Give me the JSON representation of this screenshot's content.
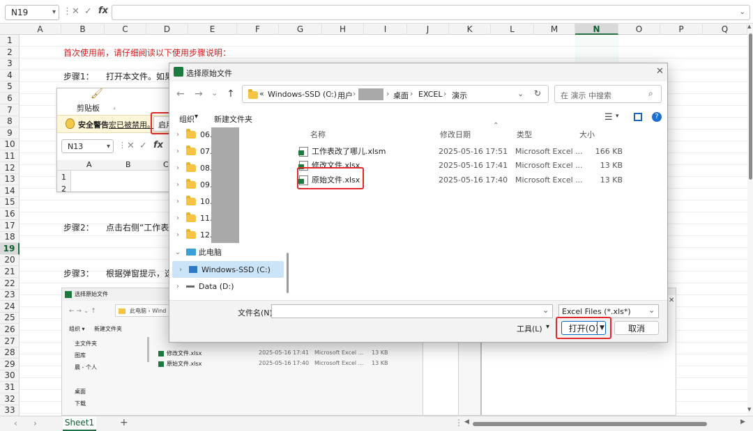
{
  "formula_bar": {
    "name_box": "N19",
    "fx": "fx"
  },
  "columns": [
    "A",
    "B",
    "C",
    "D",
    "E",
    "F",
    "G",
    "H",
    "I",
    "J",
    "K",
    "L",
    "M",
    "N",
    "O",
    "P",
    "Q"
  ],
  "selected_column": "N",
  "rows": [
    "1",
    "2",
    "3",
    "4",
    "5",
    "6",
    "7",
    "8",
    "9",
    "10",
    "11",
    "12",
    "13",
    "14",
    "15",
    "16",
    "17",
    "18",
    "19",
    "20",
    "21",
    "22",
    "23",
    "24",
    "25",
    "26",
    "27",
    "28",
    "29",
    "30",
    "31",
    "32",
    "33"
  ],
  "selected_row": "19",
  "sheet": {
    "intro": "首次使用前，请仔细阅读以下使用步骤说明：",
    "step1_label": "步骤1：",
    "step1_text": "打开本文件。如果",
    "step2_label": "步骤2：",
    "step2_text": "点击右侧“工作表",
    "step3_label": "步骤3：",
    "step3_text": "根据弹窗提示，选"
  },
  "shot1": {
    "clipboard": "剪贴板",
    "warning_label": "安全警告",
    "warning_link": "宏已被禁用。",
    "enable_btn": "启用",
    "name_box": "N13",
    "fx": "fx",
    "cols": [
      "A",
      "B",
      "C"
    ],
    "rows": [
      "1",
      "2"
    ]
  },
  "shot2": {
    "title": "选择原始文件",
    "breadcrumb": "此电脑 › Wind",
    "organize": "组织 ▾",
    "new_folder": "新建文件夹",
    "nav": [
      "主文件夹",
      "图库",
      "晨 - 个人",
      "桌面",
      "下载"
    ],
    "files": [
      {
        "name": "修改文件.xlsx",
        "date": "2025-05-16 17:41",
        "type": "Microsoft Excel ...",
        "size": "13 KB"
      },
      {
        "name": "原始文件.xlsx",
        "date": "2025-05-16 17:40",
        "type": "Microsoft Excel ...",
        "size": "13 KB"
      }
    ]
  },
  "dialog": {
    "title": "选择原始文件",
    "breadcrumb": {
      "prefix": "«",
      "drive": "Windows-SSD (C:)",
      "sep": "›",
      "users": "用户",
      "desktop": "桌面",
      "excel": "EXCEL",
      "demo": "演示"
    },
    "search_placeholder": "在 演示 中搜索",
    "organize": "组织",
    "new_folder": "新建文件夹",
    "nav_folders": [
      "06.",
      "07.",
      "08.",
      "09.",
      "10.",
      "11.",
      "12."
    ],
    "this_pc": "此电脑",
    "drive_c": "Windows-SSD (C:)",
    "drive_d": "Data (D:)",
    "headers": {
      "name": "名称",
      "date": "修改日期",
      "type": "类型",
      "size": "大小"
    },
    "files": [
      {
        "name": "工作表改了哪儿.xlsm",
        "date": "2025-05-16 17:51",
        "type": "Microsoft Excel ...",
        "size": "166 KB"
      },
      {
        "name": "修改文件.xlsx",
        "date": "2025-05-16 17:41",
        "type": "Microsoft Excel ...",
        "size": "13 KB"
      },
      {
        "name": "原始文件.xlsx",
        "date": "2025-05-16 17:40",
        "type": "Microsoft Excel ...",
        "size": "13 KB"
      }
    ],
    "filename_label": "文件名(N):",
    "filename_value": "",
    "filetype": "Excel Files (*.xls*)",
    "tools": "工具(L)",
    "open": "打开(O)",
    "cancel": "取消"
  },
  "tabs": {
    "sheet1": "Sheet1",
    "add": "+"
  },
  "colors": {
    "accent": "#217346",
    "highlight": "#e0282a",
    "red_text": "#d21c1c"
  }
}
